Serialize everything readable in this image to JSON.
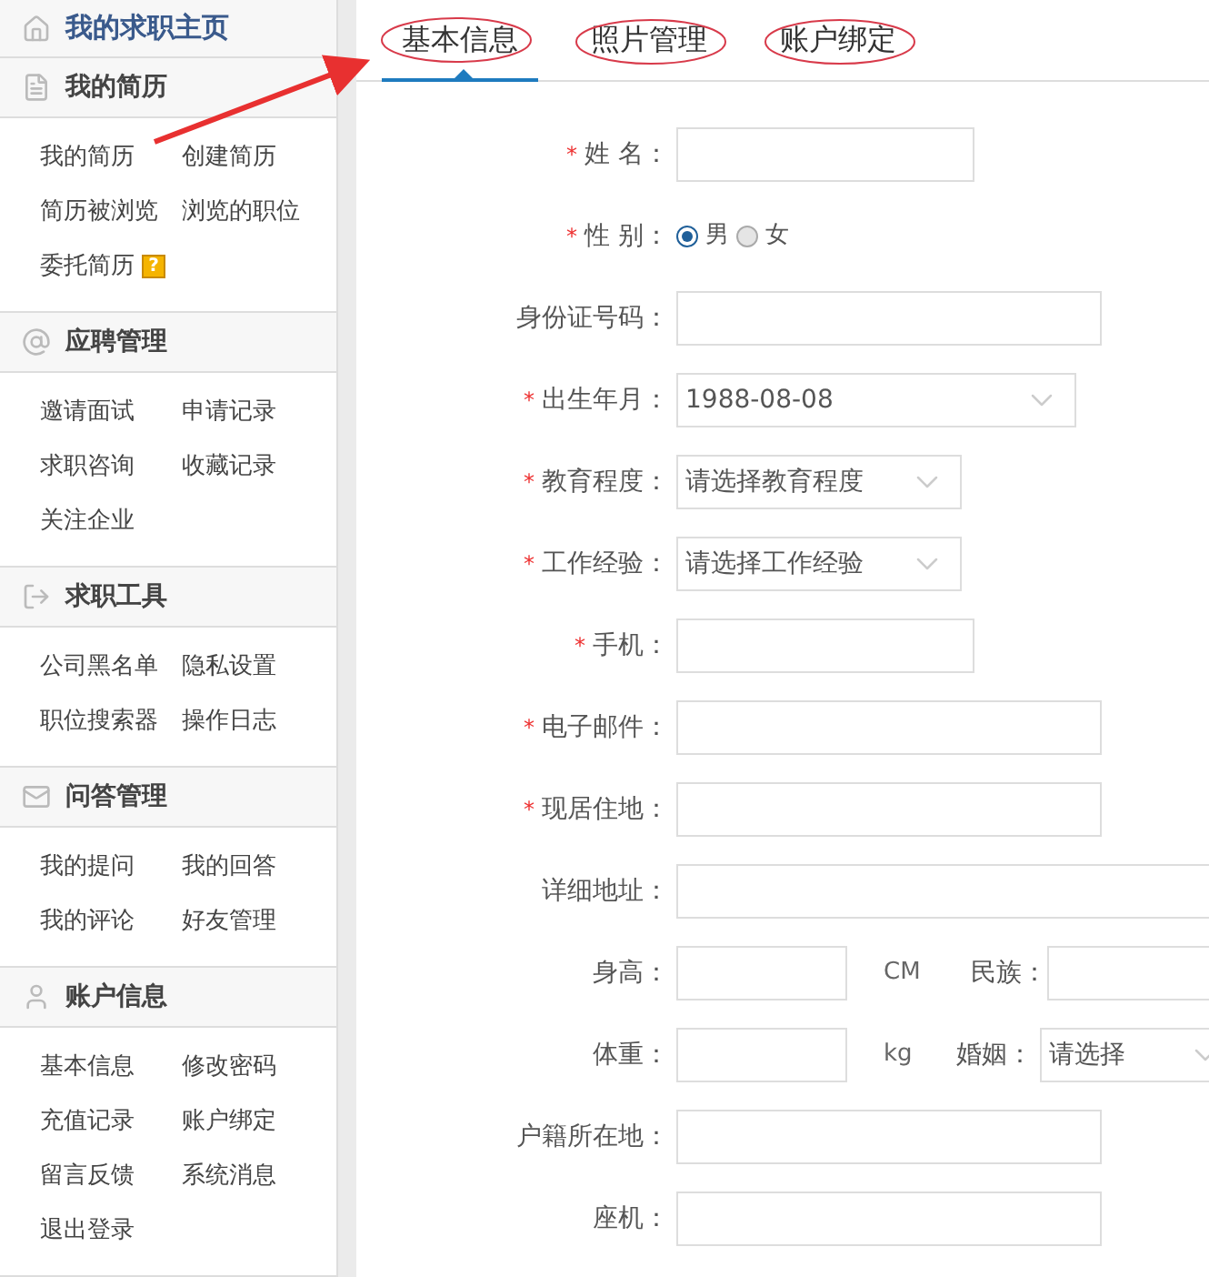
{
  "sidebar": {
    "home": "我的求职主页",
    "sections": [
      {
        "kind": "document",
        "title": "我的简历",
        "items": [
          {
            "label": "我的简历"
          },
          {
            "label": "创建简历"
          },
          {
            "label": "简历被浏览"
          },
          {
            "label": "浏览的职位"
          },
          {
            "label": "委托简历",
            "badge": "?"
          }
        ]
      },
      {
        "kind": "at",
        "title": "应聘管理",
        "items": [
          {
            "label": "邀请面试"
          },
          {
            "label": "申请记录"
          },
          {
            "label": "求职咨询"
          },
          {
            "label": "收藏记录"
          },
          {
            "label": "关注企业"
          }
        ]
      },
      {
        "kind": "exit",
        "title": "求职工具",
        "items": [
          {
            "label": "公司黑名单"
          },
          {
            "label": "隐私设置"
          },
          {
            "label": "职位搜索器"
          },
          {
            "label": "操作日志"
          }
        ]
      },
      {
        "kind": "mail",
        "title": "问答管理",
        "items": [
          {
            "label": "我的提问"
          },
          {
            "label": "我的回答"
          },
          {
            "label": "我的评论"
          },
          {
            "label": "好友管理"
          }
        ]
      },
      {
        "kind": "user",
        "title": "账户信息",
        "items": [
          {
            "label": "基本信息"
          },
          {
            "label": "修改密码"
          },
          {
            "label": "充值记录"
          },
          {
            "label": "账户绑定"
          },
          {
            "label": "留言反馈"
          },
          {
            "label": "系统消息"
          },
          {
            "label": "退出登录"
          }
        ]
      }
    ]
  },
  "tabs": [
    {
      "label": "基本信息",
      "selected": true
    },
    {
      "label": "照片管理",
      "selected": false
    },
    {
      "label": "账户绑定",
      "selected": false
    }
  ],
  "form": [
    {
      "kind": "input",
      "required_mark": "*",
      "label": "姓 名："
    },
    {
      "kind": "radio",
      "required_mark": "*",
      "label": "性 别：",
      "options": [
        {
          "label": "男",
          "selected": true
        },
        {
          "label": "女",
          "selected": false
        }
      ]
    },
    {
      "kind": "input",
      "label": "身份证号码："
    },
    {
      "kind": "select",
      "required_mark": "*",
      "label": "出生年月：",
      "value": "1988-08-08"
    },
    {
      "kind": "select",
      "required_mark": "*",
      "label": "教育程度：",
      "placeholder": "请选择教育程度"
    },
    {
      "kind": "select",
      "required_mark": "*",
      "label": "工作经验：",
      "placeholder": "请选择工作经验"
    },
    {
      "kind": "input",
      "required_mark": "*",
      "label": "手机："
    },
    {
      "kind": "input",
      "required_mark": "*",
      "label": "电子邮件："
    },
    {
      "kind": "input",
      "required_mark": "*",
      "label": "现居住地："
    },
    {
      "kind": "input",
      "label": "详细地址："
    },
    {
      "kind": "pair",
      "label": "身高：",
      "unit": "CM",
      "second": {
        "kind": "input",
        "label": "民族："
      }
    },
    {
      "kind": "pair",
      "label": "体重：",
      "unit": "kg",
      "second": {
        "kind": "select",
        "label": "婚姻：",
        "value": "请选择"
      }
    },
    {
      "kind": "input",
      "label": "户籍所在地："
    },
    {
      "kind": "input",
      "label": "座机："
    }
  ]
}
